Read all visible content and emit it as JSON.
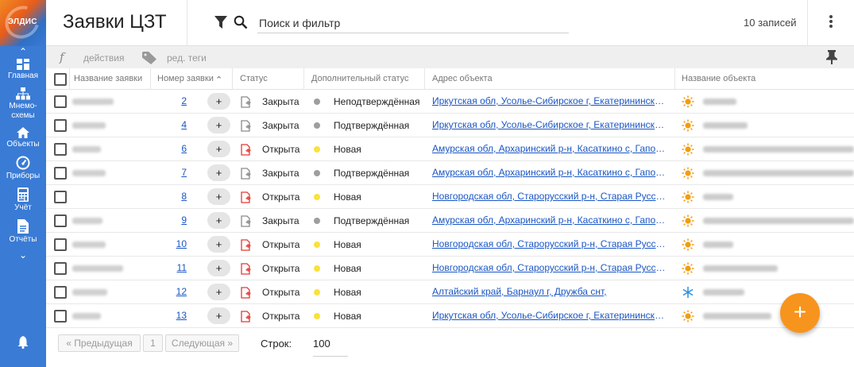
{
  "app": {
    "logo_text": "ЭЛДИС"
  },
  "sidebar": {
    "items": [
      {
        "label": "Главная",
        "icon": "dashboard-icon"
      },
      {
        "label": "Мнемо-схемы",
        "icon": "sitemap-icon"
      },
      {
        "label": "Объекты",
        "icon": "home-icon"
      },
      {
        "label": "Приборы",
        "icon": "gauge-icon"
      },
      {
        "label": "Учёт",
        "icon": "calculator-icon"
      },
      {
        "label": "Отчёты",
        "icon": "document-icon"
      }
    ],
    "bottom_icon": "bell-icon"
  },
  "header": {
    "title": "Заявки ЦЗТ",
    "search_placeholder": "Поиск и фильтр",
    "record_count": "10 записей"
  },
  "toolbar": {
    "actions_label": "действия",
    "tags_label": "ред. теги"
  },
  "table": {
    "columns": [
      "Название заявки",
      "Номер заявки",
      "Статус",
      "Дополнительный статус",
      "Адрес объекта",
      "Название объекта"
    ],
    "rows": [
      {
        "number": "2",
        "status": "Закрыта",
        "status_kind": "closed",
        "extra": "Неподтверждённая",
        "dot": "#9e9e9e",
        "address": "Иркутская обл, Усолье-Сибирское г, Екатерининская ул",
        "obj_icon": "sun"
      },
      {
        "number": "4",
        "status": "Закрыта",
        "status_kind": "closed",
        "extra": "Подтверждённая",
        "dot": "#9e9e9e",
        "address": "Иркутская обл, Усолье-Сибирское г, Екатерининская ул",
        "obj_icon": "sun"
      },
      {
        "number": "6",
        "status": "Открыта",
        "status_kind": "open",
        "extra": "Новая",
        "dot": "#fbe13b",
        "address": "Амурская обл, Архаринский р-н, Касаткино с, Гапоновская ул",
        "obj_icon": "sun"
      },
      {
        "number": "7",
        "status": "Закрыта",
        "status_kind": "closed",
        "extra": "Подтверждённая",
        "dot": "#9e9e9e",
        "address": "Амурская обл, Архаринский р-н, Касаткино с, Гапоновская ул",
        "obj_icon": "sun"
      },
      {
        "number": "8",
        "status": "Открыта",
        "status_kind": "open",
        "extra": "Новая",
        "dot": "#fbe13b",
        "address": "Новгородская обл, Старорусский р-н, Старая Русса г, Ленина ул",
        "obj_icon": "sun"
      },
      {
        "number": "9",
        "status": "Закрыта",
        "status_kind": "closed",
        "extra": "Подтверждённая",
        "dot": "#9e9e9e",
        "address": "Амурская обл, Архаринский р-н, Касаткино с, Гапоновская ул",
        "obj_icon": "sun"
      },
      {
        "number": "10",
        "status": "Открыта",
        "status_kind": "open",
        "extra": "Новая",
        "dot": "#fbe13b",
        "address": "Новгородская обл, Старорусский р-н, Старая Русса г, Ленина ул",
        "obj_icon": "sun"
      },
      {
        "number": "11",
        "status": "Открыта",
        "status_kind": "open",
        "extra": "Новая",
        "dot": "#fbe13b",
        "address": "Новгородская обл, Старорусский р-н, Старая Русса г, Ленина ул",
        "obj_icon": "sun"
      },
      {
        "number": "12",
        "status": "Открыта",
        "status_kind": "open",
        "extra": "Новая",
        "dot": "#fbe13b",
        "address": "Алтайский край, Барнаул г, Дружба снт, ",
        "obj_icon": "snow"
      },
      {
        "number": "13",
        "status": "Открыта",
        "status_kind": "open",
        "extra": "Новая",
        "dot": "#fbe13b",
        "address": "Иркутская обл, Усолье-Сибирское г, Екатерининская ул",
        "obj_icon": "sun"
      }
    ]
  },
  "pager": {
    "prev_label": "« Предыдущая",
    "page": "1",
    "next_label": "Следующая »",
    "rows_label": "Строк:",
    "rows_value": "100"
  },
  "fab": {
    "label": "+"
  },
  "colors": {
    "sidebar": "#3a7bd5",
    "accent": "#f7941d",
    "link": "#1a56c4",
    "status_open": "#e53935",
    "status_closed": "#8a8a8a"
  }
}
